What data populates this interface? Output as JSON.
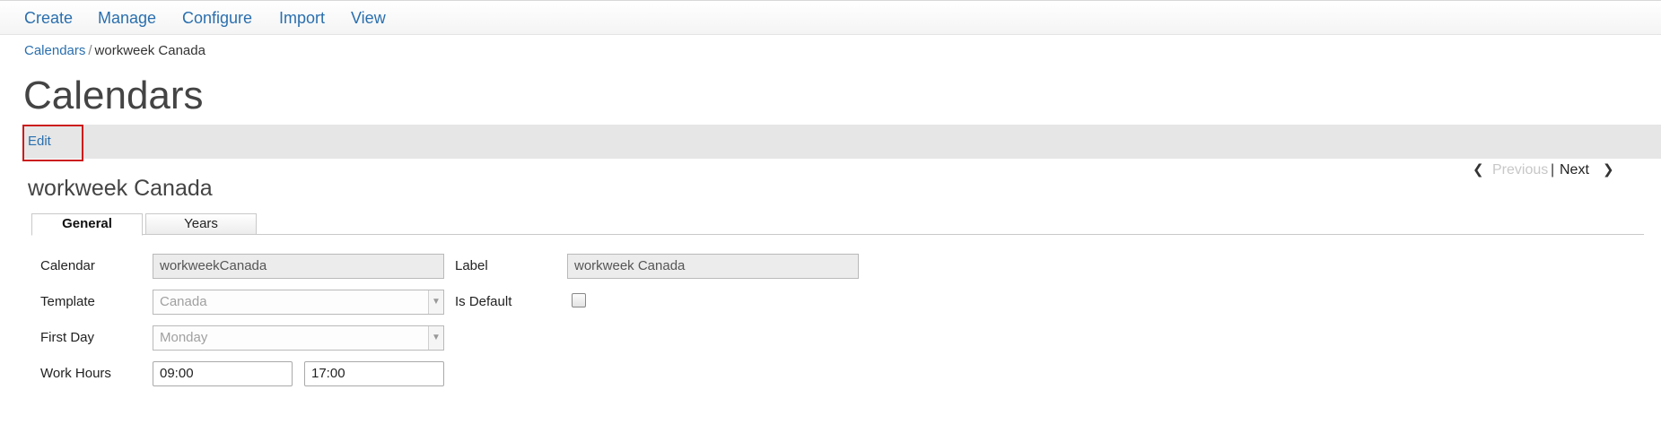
{
  "nav": {
    "items": [
      {
        "label": "Create"
      },
      {
        "label": "Manage"
      },
      {
        "label": "Configure"
      },
      {
        "label": "Import"
      },
      {
        "label": "View"
      }
    ]
  },
  "breadcrumb": {
    "parent": "Calendars",
    "separator": "/",
    "current": "workweek Canada"
  },
  "page_title": "Calendars",
  "actions": {
    "edit": "Edit"
  },
  "pager": {
    "previous": "Previous",
    "separator": "|",
    "next": "Next"
  },
  "record_title": "workweek Canada",
  "tabs": [
    {
      "label": "General"
    },
    {
      "label": "Years"
    }
  ],
  "form": {
    "calendar": {
      "label": "Calendar",
      "value": "workweekCanada"
    },
    "label": {
      "label": "Label",
      "value": "workweek Canada"
    },
    "template": {
      "label": "Template",
      "value": "Canada"
    },
    "is_default": {
      "label": "Is Default",
      "checked": false
    },
    "first_day": {
      "label": "First Day",
      "value": "Monday"
    },
    "work_hours": {
      "label": "Work Hours",
      "start": "09:00",
      "end": "17:00"
    }
  },
  "colors": {
    "link": "#2a6fae",
    "highlight_border": "#cc1b1b",
    "action_bar": "#e6e6e6"
  }
}
